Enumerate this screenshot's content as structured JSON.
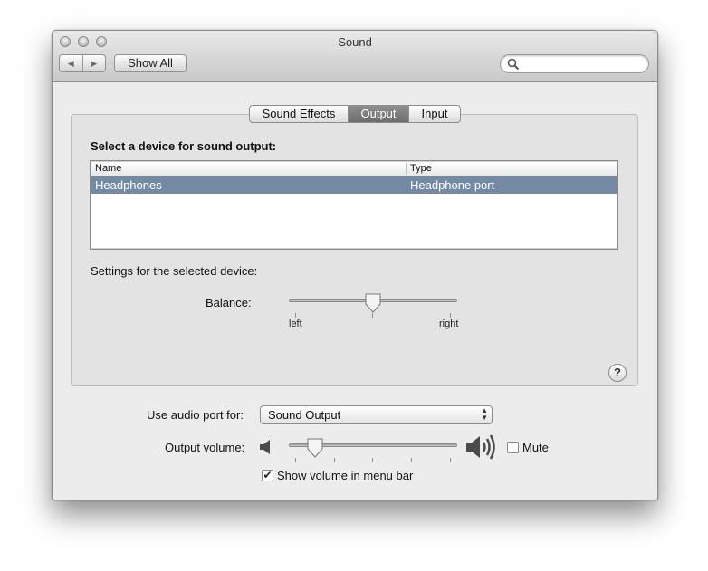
{
  "window": {
    "title": "Sound"
  },
  "toolbar": {
    "back_icon": "back-arrow-icon",
    "forward_icon": "forward-arrow-icon",
    "show_all_label": "Show All",
    "search_placeholder": "",
    "search_icon": "magnifier-icon"
  },
  "tabs": [
    {
      "label": "Sound Effects",
      "active": false
    },
    {
      "label": "Output",
      "active": true
    },
    {
      "label": "Input",
      "active": false
    }
  ],
  "output": {
    "device_prompt": "Select a device for sound output:",
    "columns": [
      "Name",
      "Type"
    ],
    "devices": [
      {
        "name": "Headphones",
        "type": "Headphone port",
        "selected": true
      }
    ],
    "settings_label": "Settings for the selected device:",
    "balance_label": "Balance:",
    "balance_left": "left",
    "balance_right": "right",
    "balance_value": 0.5,
    "help_label": "?"
  },
  "bottom": {
    "audio_port_label": "Use audio port for:",
    "audio_port_value": "Sound Output",
    "output_volume_label": "Output volume:",
    "output_volume_value": 0.16,
    "mute_label": "Mute",
    "mute_checked": false,
    "show_volume_label": "Show volume in menu bar",
    "show_volume_checked": true
  },
  "colors": {
    "selection": "#748aa4",
    "active_tab": "#7a7a7a"
  }
}
